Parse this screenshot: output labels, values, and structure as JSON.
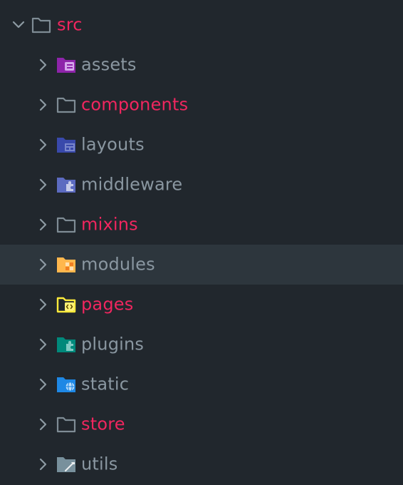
{
  "root": {
    "label": "src",
    "label_color": "#f0265f",
    "expanded": true,
    "icon": "folder-open-outline-icon"
  },
  "items": [
    {
      "label": "assets",
      "icon": "folder-assets-icon",
      "label_color": "#8a97a1"
    },
    {
      "label": "components",
      "icon": "folder-outline-icon",
      "label_color": "#f0265f"
    },
    {
      "label": "layouts",
      "icon": "folder-layouts-icon",
      "label_color": "#8a97a1"
    },
    {
      "label": "middleware",
      "icon": "folder-middleware-icon",
      "label_color": "#8a97a1"
    },
    {
      "label": "mixins",
      "icon": "folder-outline-icon",
      "label_color": "#f0265f"
    },
    {
      "label": "modules",
      "icon": "folder-modules-icon",
      "label_color": "#8a97a1",
      "selected": true
    },
    {
      "label": "pages",
      "icon": "folder-pages-icon",
      "label_color": "#f0265f"
    },
    {
      "label": "plugins",
      "icon": "folder-plugins-icon",
      "label_color": "#8a97a1"
    },
    {
      "label": "static",
      "icon": "folder-static-icon",
      "label_color": "#8a97a1"
    },
    {
      "label": "store",
      "icon": "folder-outline-icon",
      "label_color": "#f0265f"
    },
    {
      "label": "utils",
      "icon": "folder-utils-icon",
      "label_color": "#8a97a1"
    }
  ],
  "colors": {
    "background": "#21272d",
    "selected_row": "#2d363d",
    "chevron": "#8d9aa3",
    "outline_folder": "#7f8c95",
    "modified": "#f0265f",
    "default_label": "#8a97a1"
  }
}
